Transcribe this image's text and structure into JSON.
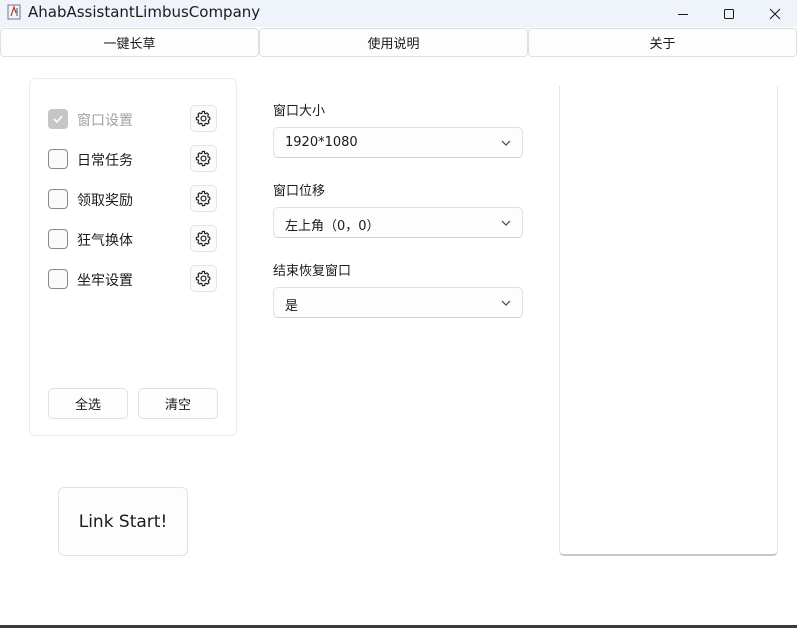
{
  "window": {
    "title": "AhabAssistantLimbusCompany",
    "icons": {
      "app": "app-icon",
      "minimize": "minimize-icon",
      "maximize": "maximize-icon",
      "close": "close-icon"
    }
  },
  "tabs": [
    {
      "label": "一键长草"
    },
    {
      "label": "使用说明"
    },
    {
      "label": "关于"
    }
  ],
  "tasks": [
    {
      "label": "窗口设置",
      "checked": true,
      "disabled": true
    },
    {
      "label": "日常任务",
      "checked": false,
      "disabled": false
    },
    {
      "label": "领取奖励",
      "checked": false,
      "disabled": false
    },
    {
      "label": "狂气换体",
      "checked": false,
      "disabled": false
    },
    {
      "label": "坐牢设置",
      "checked": false,
      "disabled": false
    }
  ],
  "task_buttons": {
    "select_all": "全选",
    "clear": "清空"
  },
  "link_start": "Link Start!",
  "settings": [
    {
      "label": "窗口大小",
      "value": "1920*1080"
    },
    {
      "label": "窗口位移",
      "value": "左上角（0，0）"
    },
    {
      "label": "结束恢复窗口",
      "value": "是"
    }
  ],
  "colors": {
    "accent_disabled": "#c6c6c6",
    "titlebar": "#eef4f9"
  }
}
